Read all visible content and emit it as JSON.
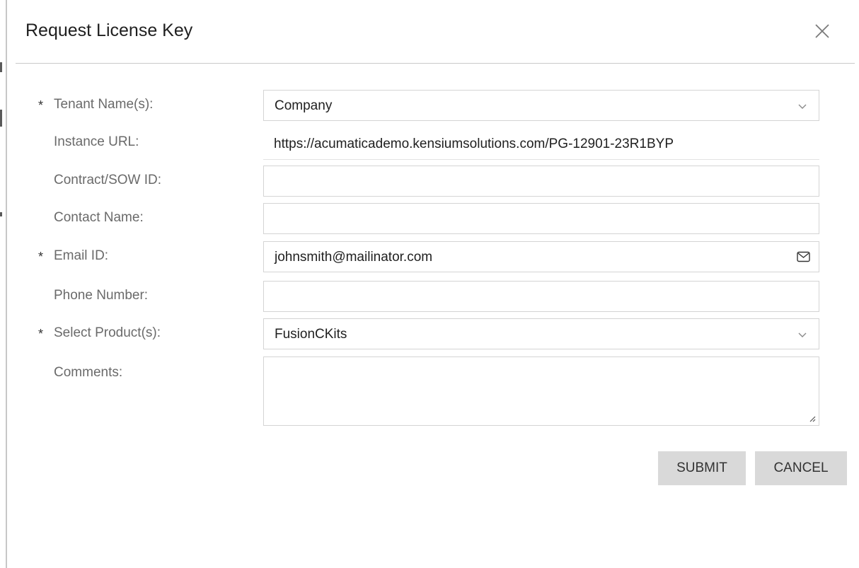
{
  "dialog": {
    "title": "Request License Key",
    "close_icon": "close-icon"
  },
  "form": {
    "tenant": {
      "label": "Tenant Name(s):",
      "required_mark": "*",
      "value": "Company"
    },
    "instance_url": {
      "label": "Instance URL:",
      "value": "https://acumaticademo.kensiumsolutions.com/PG-12901-23R1BYP"
    },
    "contract": {
      "label": "Contract/SOW ID:",
      "value": ""
    },
    "contact_name": {
      "label": "Contact Name:",
      "value": ""
    },
    "email": {
      "label": "Email ID:",
      "required_mark": "*",
      "value": "johnsmith@mailinator.com",
      "icon": "mail-icon"
    },
    "phone": {
      "label": "Phone Number:",
      "value": ""
    },
    "product": {
      "label": "Select Product(s):",
      "required_mark": "*",
      "value": "FusionCKits"
    },
    "comments": {
      "label": "Comments:",
      "value": ""
    }
  },
  "actions": {
    "submit_label": "SUBMIT",
    "cancel_label": "CANCEL"
  },
  "colors": {
    "button_bg": "#d9d9d9",
    "border": "#d4d4d4",
    "label": "#6a6a6a"
  }
}
